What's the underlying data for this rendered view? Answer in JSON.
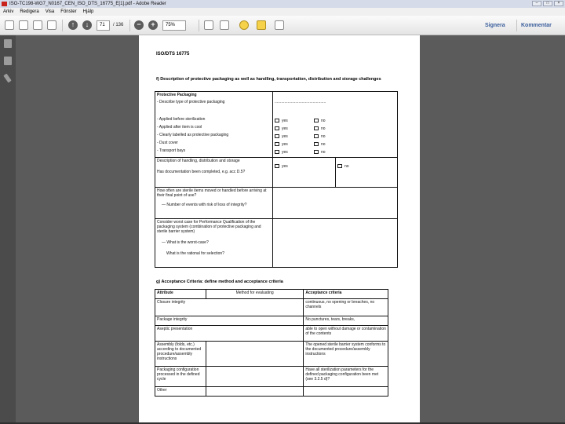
{
  "window": {
    "title": "ISO-TC198-WG7_N0167_CEN_ISO_DTS_16775_E[1].pdf - Adobe Reader",
    "controls": [
      "–",
      "□",
      "×"
    ]
  },
  "menu": [
    "Arkiv",
    "Redigera",
    "Visa",
    "Fönster",
    "Hjälp"
  ],
  "toolbar": {
    "page_number": "71",
    "page_total": "/ 136",
    "zoom": "75%",
    "sign": "Signera",
    "comment": "Kommentar"
  },
  "icons": [
    "open-icon",
    "save-icon",
    "print-icon",
    "email-icon",
    "prev-page-icon",
    "next-page-icon",
    "zoom-out-icon",
    "zoom-in-icon",
    "fit-page-icon",
    "fit-width-icon",
    "comment-icon",
    "highlight-icon",
    "fullscreen-icon"
  ],
  "sidebar_icons": [
    "pages-icon",
    "bookmarks-icon",
    "attachments-icon"
  ],
  "doc": {
    "header": "ISO/DTS 16775",
    "section_f": "f) Description of protective packaging as well as handling, transportation, distribution and storage challenges",
    "prot_title": "Protective Packaging",
    "prot_describe": "- Describe type of protective packaging",
    "prot_dots": "...............................................",
    "prot_items": [
      "- Applied before sterilization",
      "- Applied after item is cool",
      "- Clearly labelled as protective packaging",
      "- Dust cover",
      "- Transport bays"
    ],
    "yes": "yes",
    "no": "no",
    "hdsr": "Description of handling, distribution and storage",
    "hdsr_doc": "Has documentation been completed, e.g. acc D.5?",
    "moves": "How often are sterile items moved or handled before arriving at their final point of use?",
    "moves_sub": "— Number of events with risk of loss of integrity?",
    "worst": "Consider worst case for Performance Qualification of the packaging system (combination of protective packaging and sterile barrier system)",
    "worst_q1": "— What is the worst-case?",
    "worst_q2": "What is the rational for selection?",
    "section_g": "g) Acceptance Criteria: define method and acceptance criteria",
    "g_headers": [
      "Attribute",
      "Method for evaluating",
      "Acceptance criteria"
    ],
    "g_rows": [
      [
        "Closure integrity",
        "",
        "continuous, no opening or breaches, no channels"
      ],
      [
        "Package integrity",
        "",
        "No punctures, tears, breaks,"
      ],
      [
        "Aseptic presentation",
        "",
        "able to open without damage or contamination of the contents"
      ],
      [
        "Assembly (folds, etc.) according to documented procedure/assembly instructions",
        "",
        "The opened sterile barrier system conforms to the documented procedure/assembly instructions"
      ],
      [
        "Packaging configuration processed in the defined cycle",
        "",
        "Have all sterilization parameters for the defined packaging configuration been met (see 3.2.5 d)?"
      ],
      [
        "Other",
        "",
        ""
      ]
    ]
  },
  "colors": {
    "workspace": "#5b5b5b",
    "sidebar": "#4b4b4b",
    "accent": "#3a5e9c",
    "pdf_icon": "#c8221a"
  }
}
